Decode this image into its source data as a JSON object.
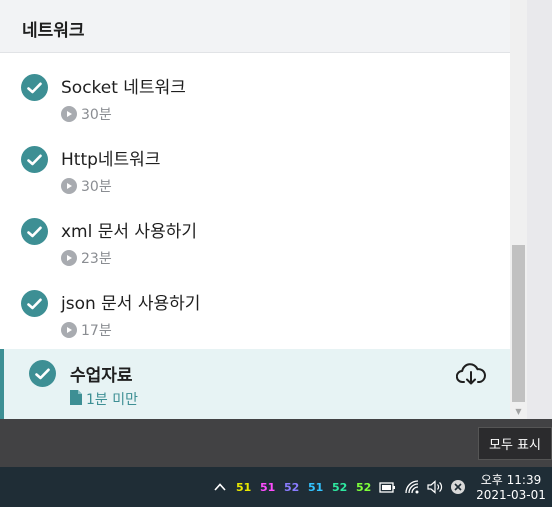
{
  "section": {
    "title": "네트워크"
  },
  "lectures": [
    {
      "title": "Socket 네트워크",
      "duration": "30분"
    },
    {
      "title": "Http네트워크",
      "duration": "30분"
    },
    {
      "title": "xml 문서 사용하기",
      "duration": "23분"
    },
    {
      "title": "json 문서 사용하기",
      "duration": "17분"
    }
  ],
  "active_lecture": {
    "title": "수업자료",
    "meta": "1분 미만"
  },
  "notification": {
    "show_all_label": "모두 표시"
  },
  "taskbar": {
    "meters": [
      {
        "value": "51",
        "color": "#e8e800"
      },
      {
        "value": "51",
        "color": "#ff4dff"
      },
      {
        "value": "52",
        "color": "#8a7cff"
      },
      {
        "value": "51",
        "color": "#33c3ff"
      },
      {
        "value": "52",
        "color": "#2ee8a0"
      },
      {
        "value": "52",
        "color": "#7dff3a"
      }
    ],
    "clock_time": "오후 11:39",
    "clock_date": "2021-03-01"
  },
  "colors": {
    "accent": "#3d8f94",
    "active_bg": "#e7f3f4"
  }
}
